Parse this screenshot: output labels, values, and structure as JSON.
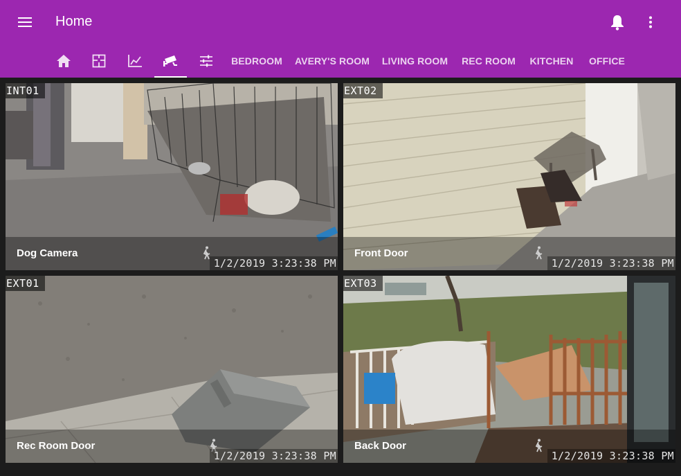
{
  "app": {
    "title": "Home",
    "accent_color": "#9c27b0"
  },
  "toolbar": {
    "menu_icon": "menu-icon",
    "notifications_icon": "bell-icon",
    "more_icon": "more-vert-icon"
  },
  "tabs": {
    "icon_tabs": [
      {
        "icon": "home-icon"
      },
      {
        "icon": "floorplan-icon"
      },
      {
        "icon": "chart-line-icon"
      },
      {
        "icon": "cctv-icon",
        "active": true
      },
      {
        "icon": "tune-icon"
      }
    ],
    "text_tabs": [
      {
        "label": "BEDROOM"
      },
      {
        "label": "AVERY'S ROOM"
      },
      {
        "label": "LIVING ROOM"
      },
      {
        "label": "REC ROOM"
      },
      {
        "label": "KITCHEN"
      },
      {
        "label": "OFFICE"
      }
    ]
  },
  "cameras": [
    {
      "id": "INT01",
      "name": "Dog Camera",
      "timestamp": "1/2/2019 3:23:38 PM",
      "icon": "motion-walk-icon"
    },
    {
      "id": "EXT02",
      "name": "Front Door",
      "timestamp": "1/2/2019 3:23:38 PM",
      "icon": "motion-walk-icon"
    },
    {
      "id": "EXT01",
      "name": "Rec Room Door",
      "timestamp": "1/2/2019 3:23:38 PM",
      "icon": "motion-walk-icon"
    },
    {
      "id": "EXT03",
      "name": "Back Door",
      "timestamp": "1/2/2019 3:23:38 PM",
      "icon": "motion-walk-icon"
    }
  ]
}
